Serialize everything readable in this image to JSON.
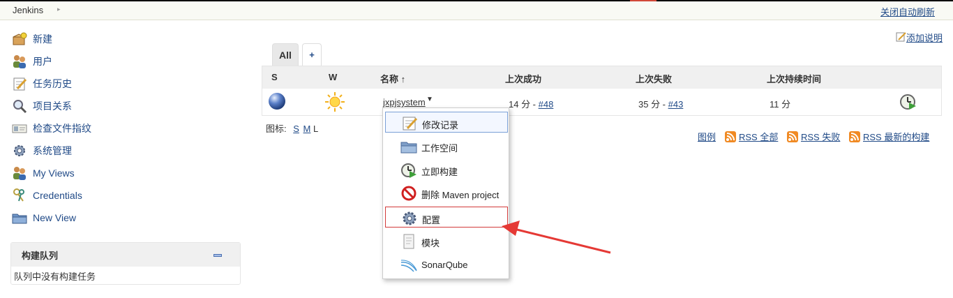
{
  "breadcrumb": {
    "home": "Jenkins",
    "autorefresh": "关闭自动刷新"
  },
  "sidebar": {
    "items": [
      {
        "label": "新建",
        "icon": "new-package-icon"
      },
      {
        "label": "用户",
        "icon": "users-icon"
      },
      {
        "label": "任务历史",
        "icon": "notepad-icon"
      },
      {
        "label": "项目关系",
        "icon": "search-icon"
      },
      {
        "label": "检查文件指纹",
        "icon": "fingerprint-card-icon"
      },
      {
        "label": "系统管理",
        "icon": "gear-icon"
      },
      {
        "label": "My Views",
        "icon": "users-icon"
      },
      {
        "label": "Credentials",
        "icon": "keys-icon"
      },
      {
        "label": "New View",
        "icon": "folder-icon"
      }
    ]
  },
  "queue": {
    "title": "构建队列",
    "empty": "队列中没有构建任务"
  },
  "tabs": {
    "all": "All",
    "add": "+"
  },
  "add_description": "添加说明",
  "table": {
    "headers": {
      "s": "S",
      "w": "W",
      "name": "名称",
      "sort": "↑",
      "last_success": "上次成功",
      "last_failure": "上次失败",
      "last_duration": "上次持续时间"
    },
    "rows": [
      {
        "name": "jxpjsystem",
        "last_success_time": "14 分 - ",
        "last_success_build": "#48",
        "last_failure_time": "35 分 - ",
        "last_failure_build": "#43",
        "duration": "11 分"
      }
    ]
  },
  "icon_size": {
    "label": "图标:",
    "s": "S",
    "m": "M",
    "l": "L"
  },
  "feeds": {
    "legend": "图例",
    "rss_all": "RSS 全部",
    "rss_failed": "RSS 失败",
    "rss_latest": "RSS 最新的构建"
  },
  "menu": {
    "items": [
      {
        "label": "修改记录",
        "icon": "notepad-icon"
      },
      {
        "label": "工作空间",
        "icon": "folder-icon"
      },
      {
        "label": "立即构建",
        "icon": "clock-play-icon"
      },
      {
        "label": "删除 Maven project",
        "icon": "no-entry-icon"
      },
      {
        "label": "配置",
        "icon": "gear-icon"
      },
      {
        "label": "模块",
        "icon": "document-icon"
      },
      {
        "label": "SonarQube",
        "icon": "sonar-waves-icon"
      }
    ]
  },
  "colors": {
    "link": "#204a87",
    "annotation": "#e53935",
    "rss": "#f08a24"
  }
}
